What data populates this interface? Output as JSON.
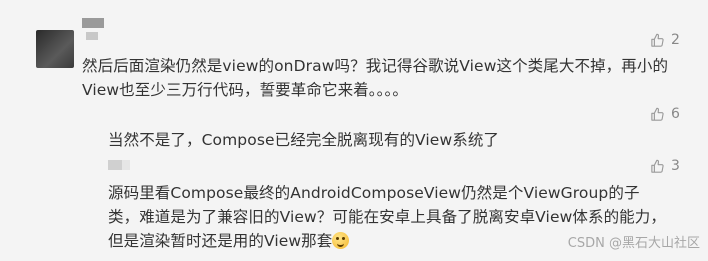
{
  "comments": [
    {
      "text": "然后后面渲染仍然是view的onDraw吗？我记得谷歌说View这个类尾大不掉，再小的View也至少三万行代码，誓要革命它来着。。。。",
      "likes": "2",
      "like_icon": "thumbs-up-icon"
    },
    {
      "text": "当然不是了，Compose已经完全脱离现有的View系统了",
      "likes": "6",
      "like_icon": "thumbs-up-icon"
    },
    {
      "text": "源码里看Compose最终的AndroidComposeView仍然是个ViewGroup的子类，难道是为了兼容旧的View？可能在安卓上具备了脱离安卓View体系的能力，但是渲染暂时还是用的View那套",
      "emoji": "grimace-emoji",
      "likes": "3",
      "like_icon": "thumbs-up-icon"
    }
  ],
  "watermark": "CSDN @黑石大山社区",
  "colors": {
    "background": "#f4f4f4",
    "text": "#333333",
    "muted": "#888888"
  }
}
